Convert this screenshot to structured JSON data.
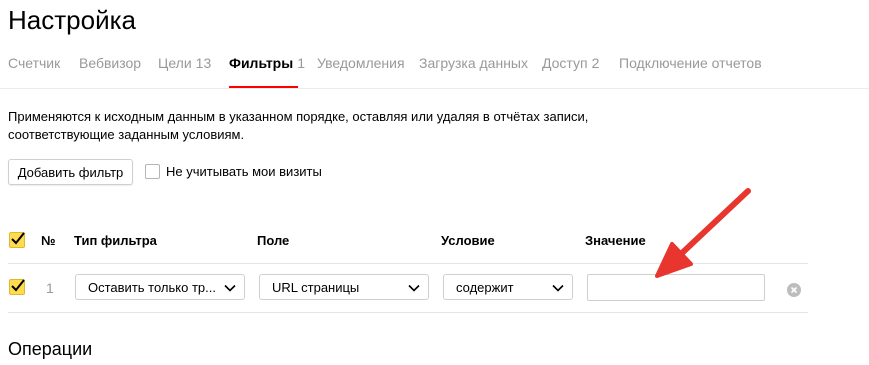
{
  "page": {
    "title": "Настройка"
  },
  "tabs": [
    {
      "label": "Счетчик",
      "count": ""
    },
    {
      "label": "Вебвизор",
      "count": ""
    },
    {
      "label": "Цели",
      "count": "13"
    },
    {
      "label": "Фильтры",
      "count": "1",
      "active": true
    },
    {
      "label": "Уведомления",
      "count": ""
    },
    {
      "label": "Загрузка данных",
      "count": ""
    },
    {
      "label": "Доступ",
      "count": "2"
    },
    {
      "label": "Подключение отчетов",
      "count": ""
    }
  ],
  "filters": {
    "description_line1": "Применяются к исходным данным в указанном порядке, оставляя или удаляя в отчётах записи,",
    "description_line2": "соответствующие заданным условиям.",
    "add_button": "Добавить фильтр",
    "ignore_visits_label": "Не учитывать мои визиты",
    "ignore_visits_checked": false,
    "columns": {
      "number": "№",
      "type": "Тип фильтра",
      "field": "Поле",
      "condition": "Условие",
      "value": "Значение"
    },
    "rows": [
      {
        "checked": true,
        "number": "1",
        "type": "Оставить только тр...",
        "field": "URL страницы",
        "condition": "содержит",
        "value": ""
      }
    ]
  },
  "operations": {
    "title": "Операции"
  },
  "annotation": {
    "arrow_color": "#e8352e"
  },
  "colors": {
    "active_tab_underline": "#ff0000",
    "checkbox_yellow": "#ffdb4d"
  }
}
